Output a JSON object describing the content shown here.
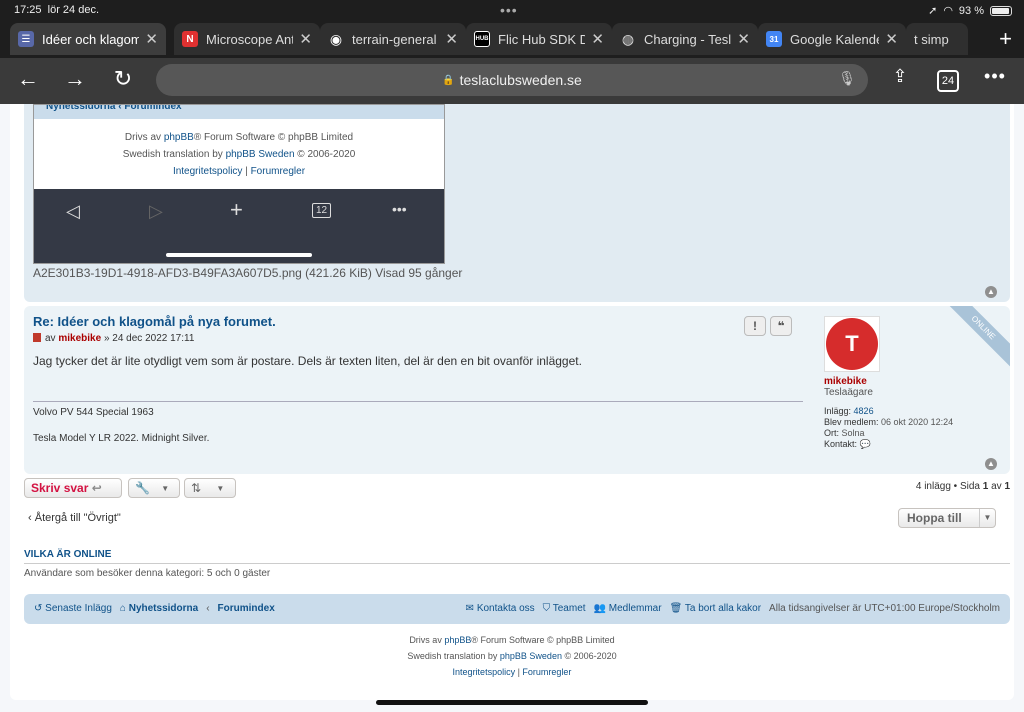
{
  "status": {
    "time": "17:25",
    "date": "lör 24 dec.",
    "battery": "93 %"
  },
  "tabs": [
    {
      "title": "Idéer och klagomål",
      "favicon_color": "#5868a8",
      "favicon_text": "",
      "active": true
    },
    {
      "title": "Microscope Ant",
      "favicon_color": "#e03131",
      "favicon_text": "N",
      "active": false
    },
    {
      "title": "terrain-general",
      "favicon_color": "#2f2f2f",
      "favicon_text": "◉",
      "active": false
    },
    {
      "title": "Flic Hub SDK D",
      "favicon_color": "#000000",
      "favicon_text": "HUB",
      "active": false
    },
    {
      "title": "Charging - Tesla",
      "favicon_color": "#2f2f2f",
      "favicon_text": "◍",
      "active": false
    },
    {
      "title": "Google Kalender",
      "favicon_color": "#4285f4",
      "favicon_text": "31",
      "active": false
    },
    {
      "title": "t simp",
      "favicon_color": "#2f2f2f",
      "favicon_text": "",
      "active": false
    }
  ],
  "toolbar": {
    "url": "teslaclubsweden.se",
    "tab_count": "24"
  },
  "attachment": {
    "inner_breadcrumb": "Nyhetssidorna  ‹  Forumindex",
    "inner_footer_line1_pre": "Drivs av ",
    "inner_footer_line1_link": "phpBB",
    "inner_footer_line1_post": "® Forum Software © phpBB Limited",
    "inner_footer_line2_pre": "Swedish translation by ",
    "inner_footer_line2_link": "phpBB Sweden",
    "inner_footer_line2_post": " © 2006-2020",
    "inner_footer_line3_a": "Integritetspolicy",
    "inner_footer_line3_b": "Forumregler",
    "inner_tab_count": "12",
    "filename": "A2E301B3-19D1-4918-AFD3-B49FA3A607D5.png (421.26 KiB) Visad 95 gånger"
  },
  "post": {
    "title": "Re: Idéer och klagomål på nya forumet.",
    "by": "av",
    "author": "mikebike",
    "date": "» 24 dec 2022 17:11",
    "body": "Jag tycker det är lite otydligt vem som är postare. Dels är texten liten, del är den en bit ovanför inlägget.",
    "sig1": "Volvo PV 544 Special 1963",
    "sig2": "Tesla Model Y LR 2022. Midnight Silver.",
    "report_label": "!",
    "quote_label": "❝"
  },
  "profile": {
    "name": "mikebike",
    "rank": "Teslaägare",
    "posts_label": "Inlägg:",
    "posts_value": "4826",
    "joined_label": "Blev medlem:",
    "joined_value": "06 okt 2020 12:24",
    "location_label": "Ort:",
    "location_value": "Solna",
    "contact_label": "Kontakt:",
    "online_badge": "ONLINE"
  },
  "actions": {
    "reply_label": "Skriv svar",
    "pagination_pre": "4 inlägg • Sida ",
    "pagination_page": "1",
    "pagination_mid": " av ",
    "pagination_total": "1"
  },
  "nav": {
    "back_label": "Återgå till \"Övrigt\"",
    "jump_label": "Hoppa till"
  },
  "online": {
    "heading": "VILKA ÄR ONLINE",
    "text": "Användare som besöker denna kategori: 5 och 0 gäster"
  },
  "footer": {
    "latest": "Senaste Inlägg",
    "news": "Nyhetssidorna",
    "index": "Forumindex",
    "contact": "Kontakta oss",
    "team": "Teamet",
    "members": "Medlemmar",
    "cookies": "Ta bort alla kakor",
    "timezone": "Alla tidsangivelser är UTC+01:00 Europe/Stockholm",
    "copy1_pre": "Drivs av ",
    "copy1_link": "phpBB",
    "copy1_post": "® Forum Software © phpBB Limited",
    "copy2_pre": "Swedish translation by ",
    "copy2_link": "phpBB Sweden",
    "copy2_post": " © 2006-2020",
    "privacy": "Integritetspolicy",
    "rules": "Forumregler"
  }
}
